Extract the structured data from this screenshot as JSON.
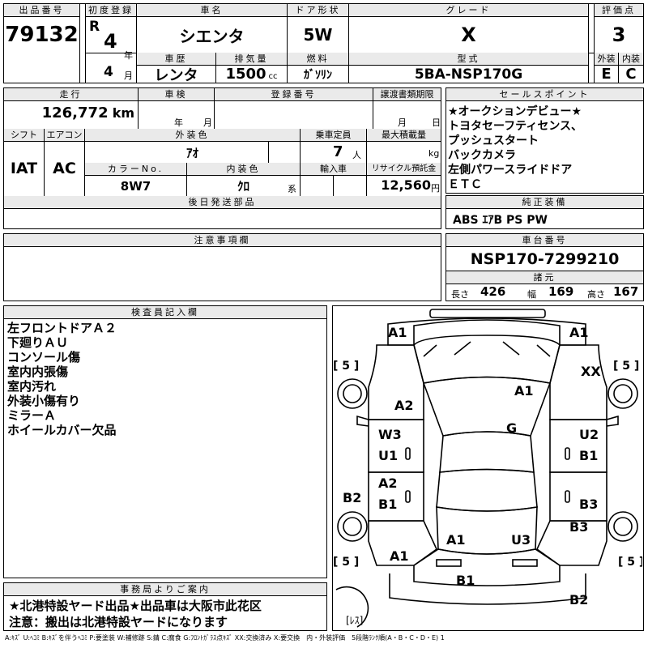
{
  "header": {
    "lot_label": "出品番号",
    "lot": "79132",
    "reg_label": "初度登録",
    "era": "R",
    "reg_year": "4",
    "year_unit": "年",
    "reg_month": "4",
    "month_unit": "月",
    "car_name_label": "車名",
    "car_name": "シエンタ",
    "door_label": "ドア形状",
    "door": "5W",
    "grade_label": "グレード",
    "grade": "X",
    "score_label": "評価点",
    "score": "3",
    "history_label": "車歴",
    "history": "レンタ",
    "displacement_label": "排気量",
    "displacement": "1500",
    "cc": "cc",
    "fuel_label": "燃料",
    "fuel": "ｶﾞｿﾘﾝ",
    "model_label": "型式",
    "model": "5BA-NSP170G",
    "exterior_label": "外装",
    "exterior": "E",
    "interior_label": "内装",
    "interior": "C"
  },
  "row2": {
    "mileage_label": "走行",
    "mileage": "126,772",
    "km": "km",
    "inspection_label": "車検",
    "year_unit": "年",
    "month_unit": "月",
    "regno_label": "登録番号",
    "transfer_label": "譲渡書類期限",
    "transfer_month": "月",
    "transfer_day": "日",
    "points_label": "セールスポイント",
    "shift_label": "シフト",
    "shift": "IAT",
    "ac_label": "エアコン",
    "ac": "AC",
    "color_label": "外装色",
    "color": "ｱｵ",
    "capacity_label": "乗車定員",
    "capacity": "7",
    "person": "人",
    "load_label": "最大積載量",
    "kg": "kg",
    "colorno_label": "カラーNo.",
    "colorno": "8W7",
    "intcolor_label": "内装色",
    "intcolor": "ｸﾛ",
    "kei": "系",
    "import_label": "輸入車",
    "recycle_label": "リサイクル預託金",
    "recycle": "12,560",
    "yen": "円",
    "later_label": "後日発送部品"
  },
  "sales_points": [
    "★オークションデビュー★",
    "トヨタセーフティセンス、",
    "プッシュスタート",
    "バックカメラ",
    "左側パワースライドドア",
    "ＥＴＣ"
  ],
  "genuine": {
    "label": "純正装備",
    "value": "ABS ｴｱB PS PW"
  },
  "notes_label": "注意事項欄",
  "chassis": {
    "label": "車台番号",
    "value": "NSP170-7299210"
  },
  "dims": {
    "label": "諸元",
    "length_label": "長さ",
    "length": "426",
    "width_label": "幅",
    "width": "169",
    "height_label": "高さ",
    "height": "167"
  },
  "inspector": {
    "label": "検査員記入欄",
    "lines": [
      "左フロントドアＡ２",
      "下廻りＡＵ",
      "コンソール傷",
      "室内内張傷",
      "室内汚れ",
      "外装小傷有り",
      "ミラーＡ",
      "ホイールカバー欠品"
    ]
  },
  "office": {
    "label": "事務局よりご案内",
    "line1": "★北港特設ヤード出品★出品車は大阪市此花区",
    "line2": "注意：搬出は北港特設ヤードになります"
  },
  "diagram": {
    "marks": [
      "A1",
      "A1",
      "XX",
      "A2",
      "A1",
      "W3",
      "U1",
      "G",
      "U2",
      "B1",
      "B2",
      "A2",
      "B1",
      "B3",
      "B3",
      "A1",
      "U3",
      "A1",
      "B1",
      "B2"
    ],
    "tires": [
      "[ 5 ]",
      "[ 5 ]",
      "[ 5 ]",
      "[ 5 ]"
    ],
    "spare": "[ﾚｽ]"
  },
  "legend": "A:ｷｽﾞ U:ﾍｺﾐ B:ｷｽﾞを伴うﾍｺﾐ P:要塗装 W:補修跡 S:錆 C:腐食 G:ﾌﾛﾝﾄｶﾞﾗｽ点ｷｽﾞ XX:交換済み X:要交換　内・外装評価　5段階ﾗﾝｸ順(A・B・C・D・E) 1"
}
